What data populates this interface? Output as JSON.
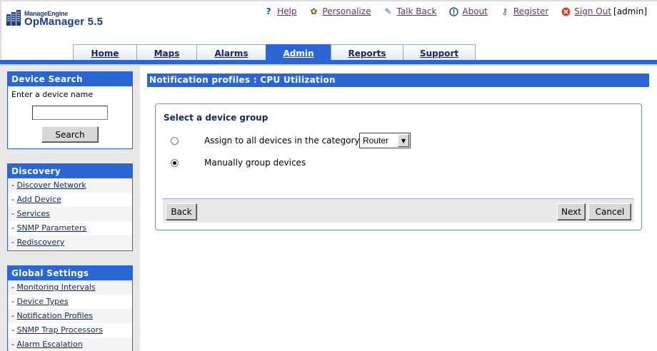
{
  "brand": {
    "small": "ManageEngine",
    "product": "OpManager 5.5"
  },
  "toplinks": [
    {
      "label": "Help",
      "icon": "question-icon"
    },
    {
      "label": "Personalize",
      "icon": "gear-icon"
    },
    {
      "label": "Talk Back",
      "icon": "pencil-icon"
    },
    {
      "label": "About",
      "icon": "info-icon"
    },
    {
      "label": "Register",
      "icon": "key-icon"
    },
    {
      "label": "Sign Out",
      "icon": "signout-icon"
    }
  ],
  "user": "[admin]",
  "tabs": [
    {
      "label": "Home",
      "active": false
    },
    {
      "label": "Maps",
      "active": false
    },
    {
      "label": "Alarms",
      "active": false
    },
    {
      "label": "Admin",
      "active": true
    },
    {
      "label": "Reports",
      "active": false
    },
    {
      "label": "Support",
      "active": false
    }
  ],
  "device_search": {
    "title": "Device Search",
    "label": "Enter a device name",
    "input_value": "",
    "button": "Search"
  },
  "discovery": {
    "title": "Discovery",
    "items": [
      "Discover Network",
      "Add Device",
      "Services",
      "SNMP Parameters",
      "Rediscovery"
    ]
  },
  "global_settings": {
    "title": "Global Settings",
    "items": [
      "Monitoring Intervals",
      "Device Types",
      "Notification Profiles",
      "SNMP Trap Processors",
      "Alarm Escalation"
    ]
  },
  "main": {
    "title": "Notification profiles : CPU Utilization",
    "card_title": "Select a device group",
    "option_all": "Assign to all devices in the category",
    "category_selected": "Router",
    "option_manual": "Manually group devices",
    "selected_option": "manual",
    "back_button": "Back",
    "next_button": "Next",
    "cancel_button": "Cancel"
  },
  "colors": {
    "accent": "#2a66d6",
    "link": "#6b2a6b",
    "nav_text": "#14285a"
  }
}
